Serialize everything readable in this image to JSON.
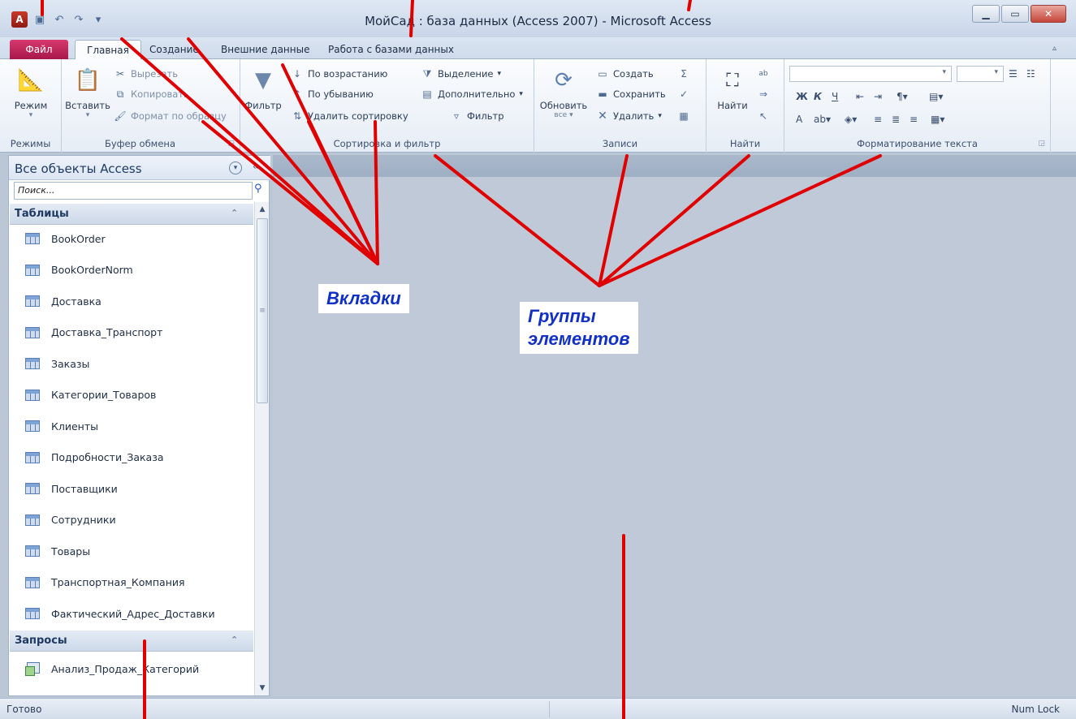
{
  "window": {
    "title": "МойСад : база данных (Access 2007) - Microsoft Access",
    "minimize_icon": "minimize-icon",
    "maximize_icon": "maximize-icon",
    "close_icon": "close-icon"
  },
  "quick_access": {
    "save_icon": "save-icon",
    "undo_icon": "undo-icon",
    "redo_icon": "redo-icon",
    "customize_icon": "customize-icon"
  },
  "tabs": [
    {
      "label": "Файл"
    },
    {
      "label": "Главная"
    },
    {
      "label": "Создание"
    },
    {
      "label": "Внешние данные"
    },
    {
      "label": "Работа с базами данных"
    }
  ],
  "ribbon": {
    "views": {
      "label": "Режимы",
      "mode_button": "Режим"
    },
    "clipboard": {
      "label": "Буфер обмена",
      "paste": "Вставить",
      "cut": "Вырезать",
      "copy": "Копировать",
      "format_painter": "Формат по образцу"
    },
    "sort_filter": {
      "label": "Сортировка и фильтр",
      "filter": "Фильтр",
      "ascending": "По возрастанию",
      "descending": "По убыванию",
      "remove_sort": "Удалить сортировку",
      "selection": "Выделение",
      "advanced": "Дополнительно",
      "toggle_filter": "Фильтр"
    },
    "records": {
      "label": "Записи",
      "refresh": "Обновить",
      "refresh_sub": "все",
      "new": "Создать",
      "save": "Сохранить",
      "delete": "Удалить"
    },
    "find": {
      "label": "Найти",
      "find_button": "Найти"
    },
    "text_format": {
      "label": "Форматирование текста",
      "bold": "Ж",
      "italic": "К",
      "underline": "Ч",
      "font_color": "A"
    }
  },
  "nav_pane": {
    "title": "Все объекты Access",
    "search_placeholder": "Поиск...",
    "sections": [
      {
        "title": "Таблицы",
        "items": [
          "BookOrder",
          "BookOrderNorm",
          "Доставка",
          "Доставка_Транспорт",
          "Заказы",
          "Категории_Товаров",
          "Клиенты",
          "Подробности_Заказа",
          "Поставщики",
          "Сотрудники",
          "Товары",
          "Транспортная_Компания",
          "Фактический_Адрес_Доставки"
        ]
      },
      {
        "title": "Запросы",
        "items": [
          "Анализ_Продаж_Категорий"
        ]
      }
    ]
  },
  "status": {
    "left": "Готово",
    "right": "Num Lock"
  },
  "annotations": {
    "tabs_label": "Вкладки",
    "groups_label_line1": "Группы",
    "groups_label_line2": "элементов",
    "color": "#e00000"
  }
}
